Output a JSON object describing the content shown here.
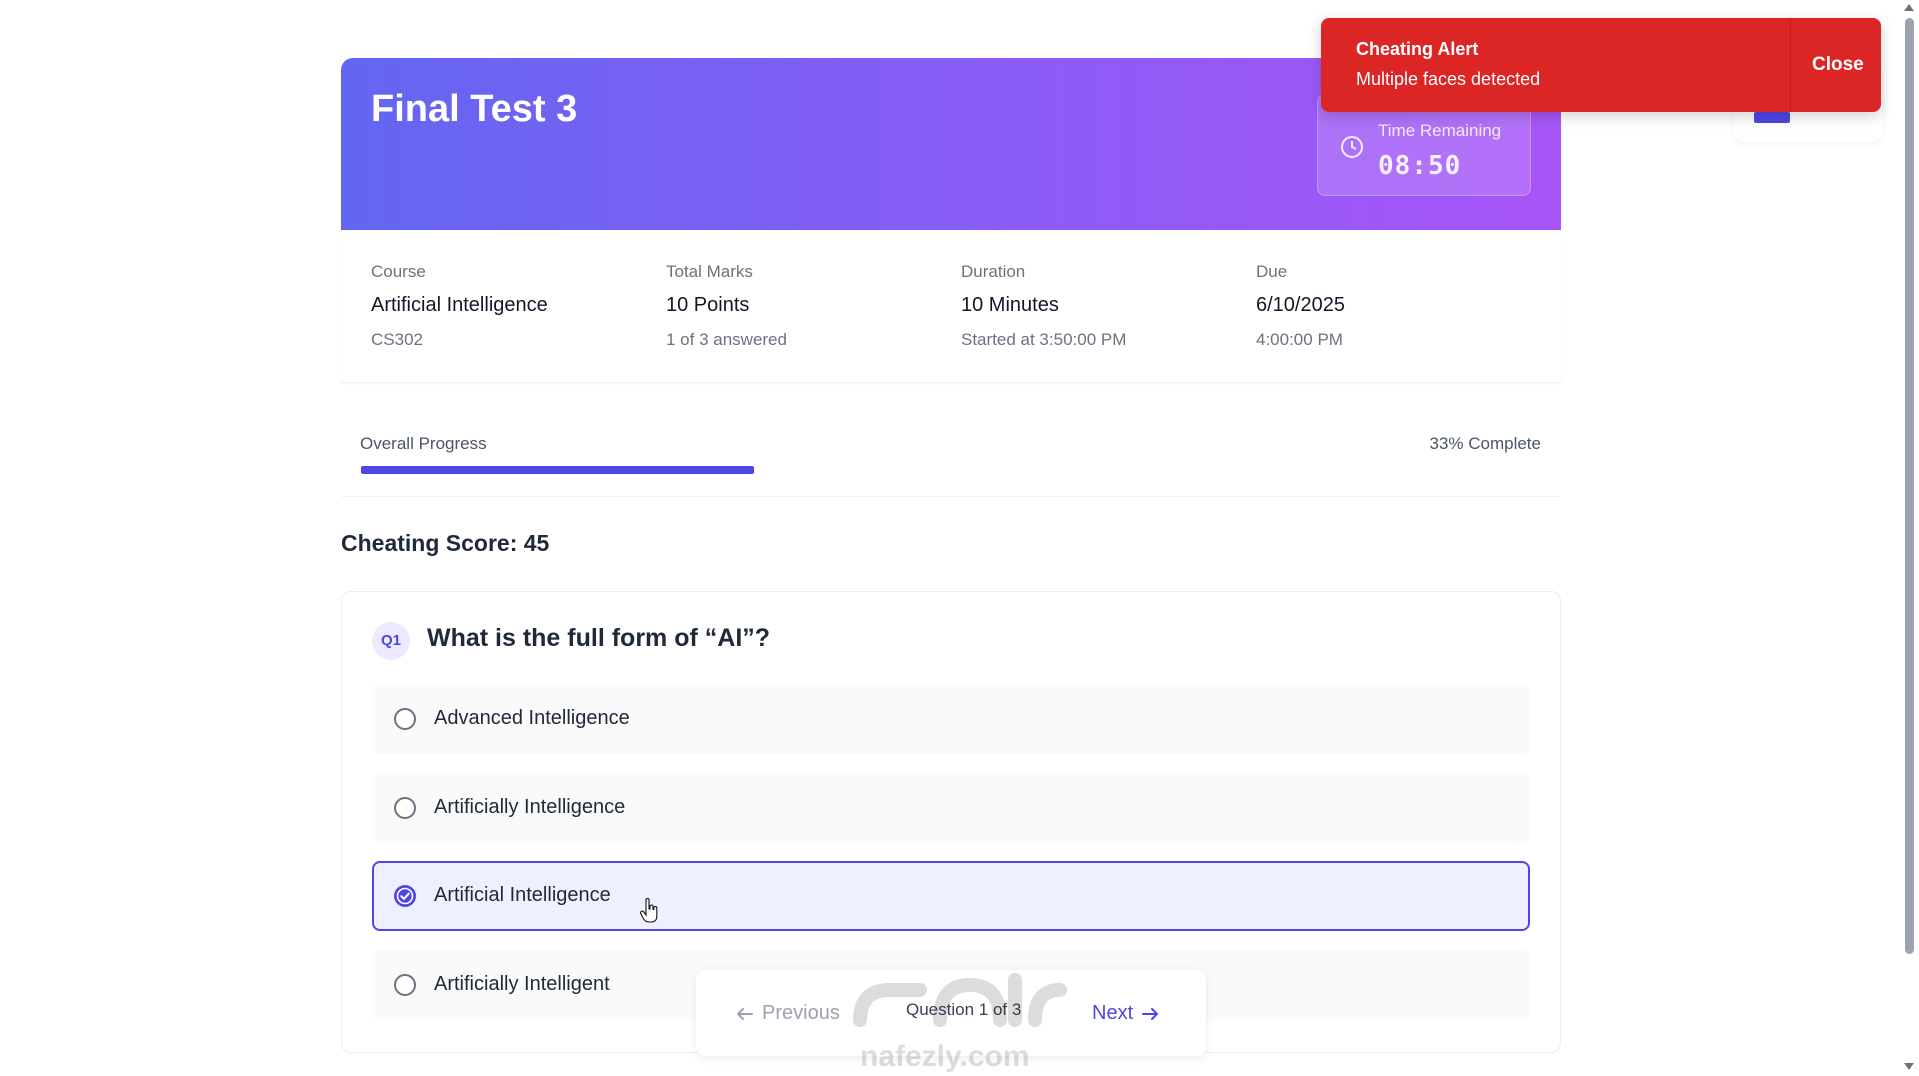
{
  "test": {
    "title": "Final Test 3",
    "timer_label": "Time Remaining",
    "timer_value": "08:50"
  },
  "info": {
    "course": {
      "label": "Course",
      "value": "Artificial Intelligence",
      "sub": "CS302"
    },
    "marks": {
      "label": "Total Marks",
      "value": "10 Points",
      "sub": "1 of 3 answered"
    },
    "duration": {
      "label": "Duration",
      "value": "10 Minutes",
      "sub": "Started at 3:50:00 PM"
    },
    "due": {
      "label": "Due",
      "value": "6/10/2025",
      "sub": "4:00:00 PM"
    }
  },
  "progress": {
    "label": "Overall Progress",
    "percent_text": "33% Complete",
    "fraction": 0.333
  },
  "cheating": {
    "score_text": "Cheating Score: 45"
  },
  "question": {
    "badge": "Q1",
    "text": "What is the full form of “AI”?",
    "options": [
      {
        "label": "Advanced Intelligence",
        "selected": false
      },
      {
        "label": "Artificially Intelligence",
        "selected": false
      },
      {
        "label": "Artificial Intelligence",
        "selected": true
      },
      {
        "label": "Artificially Intelligent",
        "selected": false
      }
    ]
  },
  "pager": {
    "prev_label": "Previous",
    "info": "Question 1 of 3",
    "next_label": "Next"
  },
  "alert": {
    "title": "Cheating Alert",
    "message": "Multiple faces detected",
    "close_label": "Close"
  },
  "watermark": {
    "text": "nafezly.com"
  },
  "colors": {
    "accent": "#4f46e5",
    "banner_start": "#6366f1",
    "banner_end": "#a855f7",
    "alert_red": "#dc2626"
  },
  "icons": {
    "timer": "clock-icon",
    "prev": "arrow-left-icon",
    "next": "arrow-right-icon",
    "selected_option": "check-circle-icon"
  }
}
